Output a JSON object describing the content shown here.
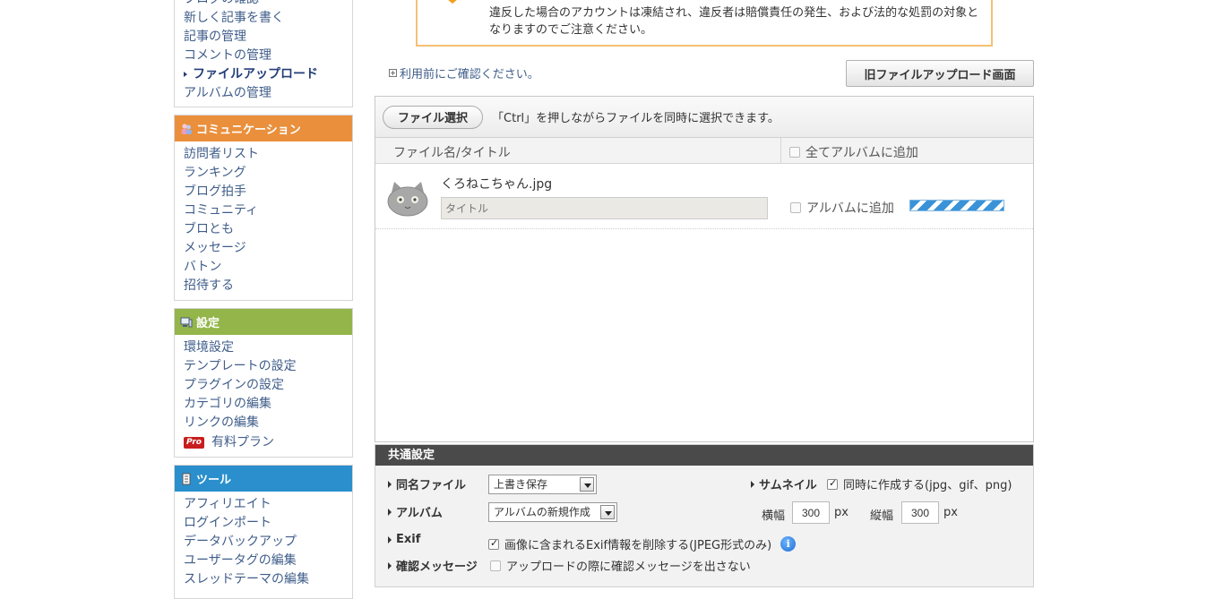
{
  "sidebar": {
    "blog_group": {
      "items": [
        "ブログの確認",
        "新しく記事を書く",
        "記事の管理",
        "コメントの管理",
        "ファイルアップロード",
        "アルバムの管理"
      ]
    },
    "communication": {
      "title": "コミュニケーション",
      "color": "#ea8f3c",
      "items": [
        "訪問者リスト",
        "ランキング",
        "ブログ拍手",
        "コミュニティ",
        "ブロとも",
        "メッセージ",
        "バトン",
        "招待する"
      ]
    },
    "settings": {
      "title": "設定",
      "color": "#93b54a",
      "items": [
        "環境設定",
        "テンプレートの設定",
        "プラグインの設定",
        "カテゴリの編集",
        "リンクの編集"
      ],
      "pro_badge": "Pro",
      "pro_label": "有料プラン"
    },
    "tools": {
      "title": "ツール",
      "color": "#2a8fcc",
      "items": [
        "アフィリエイト",
        "ログインポート",
        "データバックアップ",
        "ユーザータグの編集",
        "スレッドテーマの編集"
      ]
    }
  },
  "warning": {
    "line1": "違反した場合のアカウントは凍結され、違反者は賠償責任の発生、および法的な処罰の対象と",
    "line2": "なりますのでご注意ください。"
  },
  "notice_link": "利用前にご確認ください。",
  "old_upload_button": "旧ファイルアップロード画面",
  "upload": {
    "file_select_button": "ファイル選択",
    "hint": "「Ctrl」を押しながらファイルを同時に選択できます。",
    "col_filename": "ファイル名/タイトル",
    "col_add_all": "全てアルバムに追加",
    "files": [
      {
        "name": "くろねこちゃん.jpg",
        "title_placeholder": "タイトル",
        "album_label": "アルバムに追加",
        "progress": 1.0
      }
    ]
  },
  "common_settings": {
    "header": "共通設定",
    "same_name_label": "同名ファイル",
    "same_name_value": "上書き保存",
    "album_label": "アルバム",
    "album_value": "アルバムの新規作成",
    "exif_label": "Exif",
    "exif_option": "画像に含まれるExif情報を削除する(JPEG形式のみ)",
    "confirm_label": "確認メッセージ",
    "confirm_option": "アップロードの際に確認メッセージを出さない",
    "thumbnail_label": "サムネイル",
    "thumbnail_option": "同時に作成する(jpg、gif、png)",
    "width_label": "横幅",
    "width_value": "300",
    "height_label": "縦幅",
    "height_value": "300",
    "px": "px"
  }
}
